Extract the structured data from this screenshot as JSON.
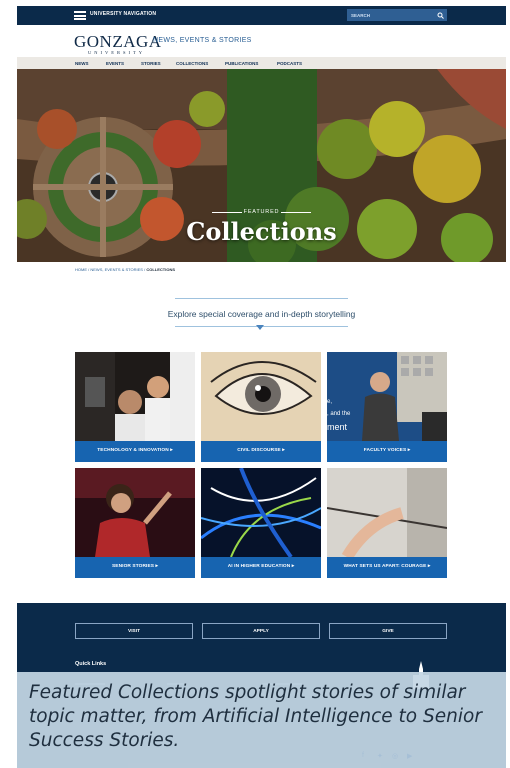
{
  "topbar": {
    "nav_label": "UNIVERSITY NAVIGATION",
    "search_placeholder": "SEARCH"
  },
  "logo": {
    "main": "GONZAGA",
    "sub": "UNIVERSITY"
  },
  "site_title": "NEWS, EVENTS & STORIES",
  "subnav": [
    "NEWS",
    "EVENTS",
    "STORIES",
    "COLLECTIONS",
    "PUBLICATIONS",
    "PODCASTS"
  ],
  "hero": {
    "kicker": "FEATURED",
    "title": "Collections"
  },
  "breadcrumb": {
    "home": "HOME",
    "sep": "/",
    "section": "NEWS, EVENTS & STORIES",
    "current": "COLLECTIONS"
  },
  "intro": "Explore special coverage and in-depth storytelling",
  "tiles": [
    {
      "label": "TECHNOLOGY & INNOVATION ▸"
    },
    {
      "label": "CIVIL DISCOURSE ▸"
    },
    {
      "label": "FACULTY VOICES ▸"
    },
    {
      "label": "SENIOR STORIES ▸"
    },
    {
      "label": "AI IN HIGHER EDUCATION ▸"
    },
    {
      "label": "WHAT SETS US APART: COURAGE ▸"
    }
  ],
  "tile_overlay_text": {
    "line1": "e,",
    "line2": ", and the",
    "line3": "ment"
  },
  "footer": {
    "buttons": [
      "VISIT",
      "APPLY",
      "GIVE"
    ],
    "quick_links_title": "Quick Links"
  },
  "caption": "Featured Collections spotlight stories of similar topic matter, from Artificial Intelligence to Senior Success Stories.",
  "colors": {
    "navy": "#0b2a4a",
    "tile_bar": "#1764b0",
    "link_blue": "#2a5f94"
  }
}
